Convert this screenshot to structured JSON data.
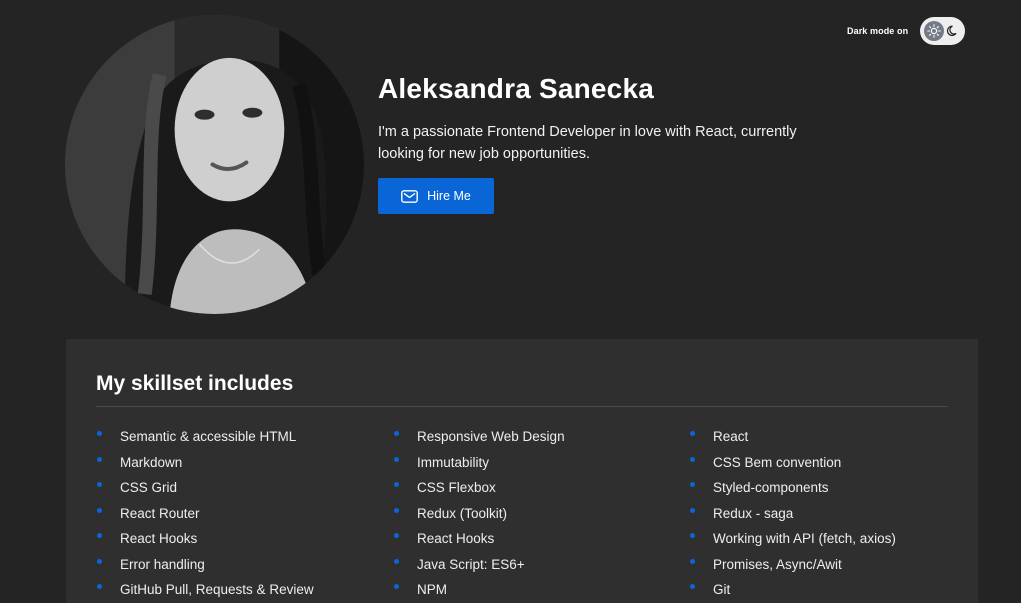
{
  "theme": {
    "label": "Dark mode on",
    "sun_icon": "sun-icon",
    "moon_icon": "moon-icon"
  },
  "header": {
    "name": "Aleksandra Sanecka",
    "intro": "I'm a passionate Frontend Developer in love with React, currently looking for new job opportunities.",
    "hire_button": {
      "label": "Hire Me",
      "icon": "mail-icon"
    }
  },
  "skills": {
    "title": "My skillset includes",
    "columns": [
      [
        "Semantic & accessible HTML",
        "Markdown",
        "CSS Grid",
        "React Router",
        "React Hooks",
        "Error handling",
        "GitHub Pull, Requests & Review"
      ],
      [
        "Responsive Web Design",
        "Immutability",
        "CSS Flexbox",
        "Redux (Toolkit)",
        "React Hooks",
        "Java Script: ES6+",
        "NPM"
      ],
      [
        "React",
        "CSS Bem convention",
        "Styled-components",
        "Redux - saga",
        "Working with API (fetch, axios)",
        "Promises, Async/Awit",
        "Git"
      ]
    ]
  },
  "colors": {
    "background": "#242424",
    "panel": "#2f2f2f",
    "accent": "#0a66d6",
    "text": "#ffffff"
  }
}
